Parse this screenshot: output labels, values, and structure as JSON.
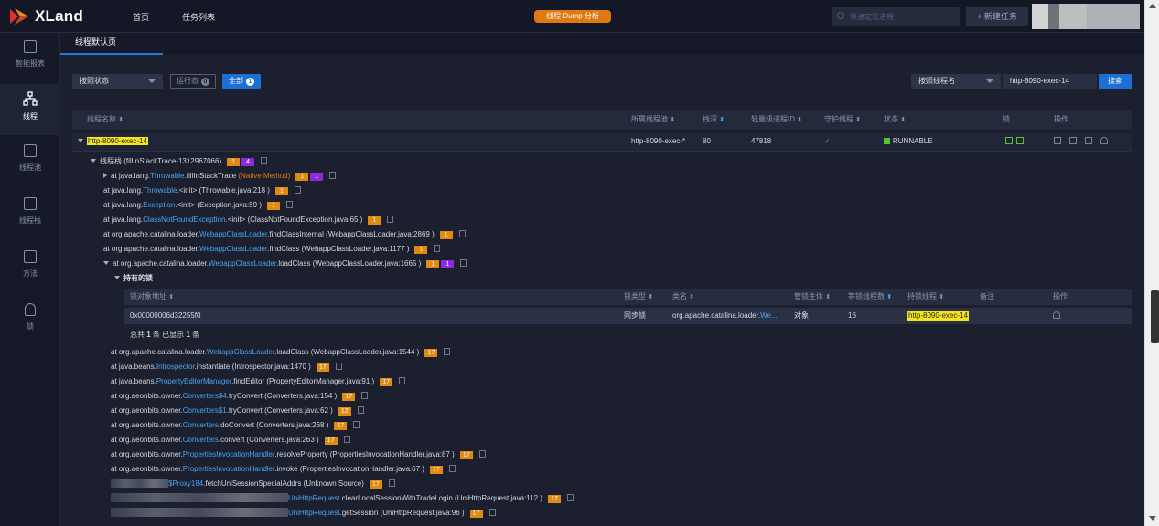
{
  "app": {
    "logo_text": "XLand"
  },
  "topnav": {
    "items": [
      "首页",
      "任务列表"
    ]
  },
  "center_button": "线程 Dump 分析",
  "quick_search": {
    "placeholder": "快速定位进程"
  },
  "new_task": "+ 新建任务",
  "sidebar": [
    {
      "label": "智能报表",
      "icon": "report-icon"
    },
    {
      "label": "线程",
      "icon": "thread-tree-icon",
      "active": true
    },
    {
      "label": "线程池",
      "icon": "thread-pool-icon"
    },
    {
      "label": "线程栈",
      "icon": "thread-stack-icon"
    },
    {
      "label": "方法",
      "icon": "method-icon"
    },
    {
      "label": "锁",
      "icon": "lock-icon"
    }
  ],
  "tab": "线程默认页",
  "filters": {
    "status_select": "按照状态",
    "running_pill": "运行态",
    "running_count": "0",
    "all_pill": "全部",
    "all_count": "1",
    "name_select": "按照线程名",
    "name_value": "http-8090-exec-14",
    "search_button": "搜索"
  },
  "table": {
    "headers": {
      "name": "线程名称",
      "pool": "所属线程池",
      "depth": "栈深",
      "lwp": "轻量级进程ID",
      "daemon": "守护线程",
      "state": "状态",
      "lock": "锁",
      "ops": "操作"
    },
    "row": {
      "name": "http-8090-exec-14",
      "pool": "http-8090-exec-*",
      "depth": "80",
      "lwp": "47818",
      "daemon": "✓",
      "state": "RUNNABLE"
    }
  },
  "stack": {
    "root": "线程栈",
    "root_detail": "(fillInStackTrace-1312967066)",
    "root_badge1": "1",
    "root_badge2": "4",
    "frames": [
      {
        "prefix": "at java.lang.",
        "cls": "Throwable",
        "method": ".fillInStackTrace",
        "src": "(Native Method)",
        "native": true,
        "b1": "1",
        "b2": "1"
      },
      {
        "prefix": "at java.lang.",
        "cls": "Throwable",
        "method": ".<init>",
        "src": "(Throwable.java:218 )",
        "b1": "1"
      },
      {
        "prefix": "at java.lang.",
        "cls": "Exception",
        "method": ".<init>",
        "src": "(Exception.java:59 )",
        "b1": "1"
      },
      {
        "prefix": "at java.lang.",
        "cls": "ClassNotFoundException",
        "method": ".<init>",
        "src": "(ClassNotFoundException.java:65 )",
        "b1": "1"
      },
      {
        "prefix": "at org.apache.catalina.loader.",
        "cls": "WebappClassLoader",
        "method": ".findClassInternal",
        "src": "(WebappClassLoader.java:2869 )",
        "b1": "1"
      },
      {
        "prefix": "at org.apache.catalina.loader.",
        "cls": "WebappClassLoader",
        "method": ".findClass",
        "src": "(WebappClassLoader.java:1177 )",
        "b1": "1"
      },
      {
        "prefix": "at org.apache.catalina.loader.",
        "cls": "WebappClassLoader",
        "method": ".loadClass",
        "src": "(WebappClassLoader.java:1665 )",
        "b1": "1",
        "b2": "1"
      }
    ],
    "held_locks": "持有的锁",
    "lock_table": {
      "headers": {
        "addr": "锁对象地址",
        "type": "锁类型",
        "cls": "类名",
        "subject": "管锁主体",
        "waiting": "等锁线程数",
        "holder": "持锁线程",
        "note": "备注",
        "ops": "操作"
      },
      "row": {
        "addr": "0x00000006d32255f0",
        "type": "同步锁",
        "cls_prefix": "org.apache.catalina.loader.",
        "cls_hl": "We...",
        "subject": "对象",
        "waiting": "16",
        "holder": "http-8090-exec-14"
      },
      "summary_pre": "总共",
      "summary_total": "1",
      "summary_mid": "条 已显示",
      "summary_shown": "1",
      "summary_post": "条"
    },
    "frames2": [
      {
        "prefix": "at org.apache.catalina.loader.",
        "cls": "WebappClassLoader",
        "method": ".loadClass",
        "src": "(WebappClassLoader.java:1544 )",
        "b1": "17"
      },
      {
        "prefix": "at java.beans.",
        "cls": "Introspector",
        "method": ".instantiate",
        "src": "(Introspector.java:1470 )",
        "b1": "17"
      },
      {
        "prefix": "at java.beans.",
        "cls": "PropertyEditorManager",
        "method": ".findEditor",
        "src": "(PropertyEditorManager.java:91 )",
        "b1": "17"
      },
      {
        "prefix": "at org.aeonbits.owner.",
        "cls": "Converters$4",
        "method": ".tryConvert",
        "src": "(Converters.java:154 )",
        "b1": "17"
      },
      {
        "prefix": "at org.aeonbits.owner.",
        "cls": "Converters$1",
        "method": ".tryConvert",
        "src": "(Converters.java:62 )",
        "b1": "12"
      },
      {
        "prefix": "at org.aeonbits.owner.",
        "cls": "Converters",
        "method": ".doConvert",
        "src": "(Converters.java:268 )",
        "b1": "17"
      },
      {
        "prefix": "at org.aeonbits.owner.",
        "cls": "Converters",
        "method": ".convert",
        "src": "(Converters.java:263 )",
        "b1": "17"
      },
      {
        "prefix": "at org.aeonbits.owner.",
        "cls": "PropertiesInvocationHandler",
        "method": ".resolveProperty",
        "src": "(PropertiesInvocationHandler.java:87 )",
        "b1": "17"
      },
      {
        "prefix": "at org.aeonbits.owner.",
        "cls": "PropertiesInvocationHandler",
        "method": ".invoke",
        "src": "(PropertiesInvocationHandler.java:67 )",
        "b1": "17"
      },
      {
        "prefix": "",
        "cls": "$Proxy184",
        "method": ".fetchUniSessionSpecialAddrs",
        "src": "(Unknown Source)",
        "b1": "17",
        "blur": "short"
      },
      {
        "prefix": "",
        "cls": "UniHttpRequest",
        "method": ".clearLocalSessionWithTradeLogin",
        "src": "(UniHttpRequest.java:112 )",
        "b1": "17",
        "blur": "long"
      },
      {
        "prefix": "",
        "cls": "UniHttpRequest",
        "method": ".getSession",
        "src": "(UniHttpRequest.java:96 )",
        "b1": "17",
        "blur": "long"
      }
    ]
  }
}
